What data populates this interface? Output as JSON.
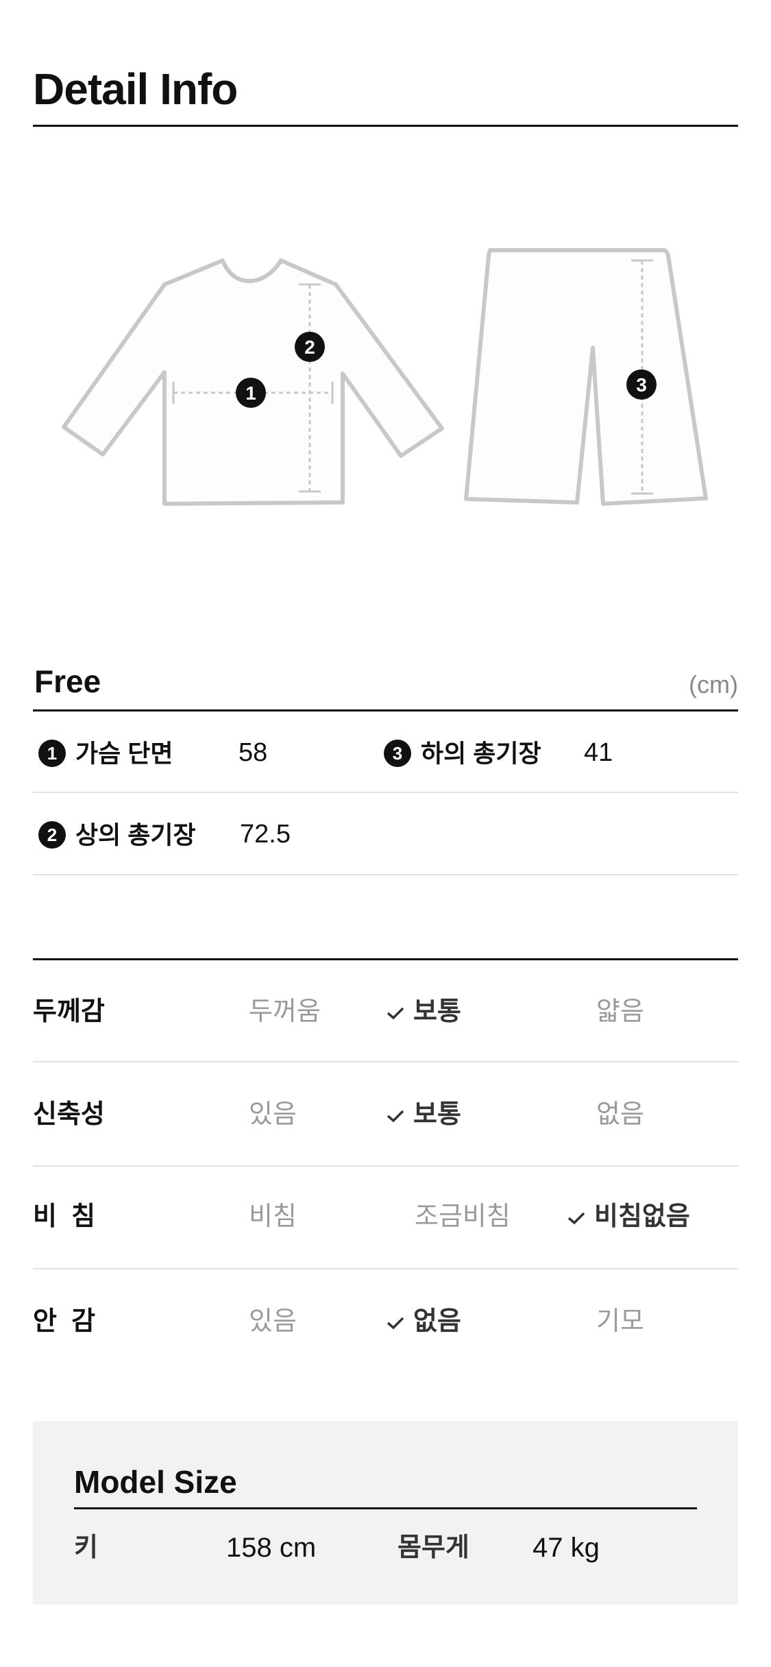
{
  "page": {
    "title": "Detail Info"
  },
  "diagram": {
    "top_markers": [
      "1",
      "2"
    ],
    "bottom_markers": [
      "3"
    ]
  },
  "size_table": {
    "size_name": "Free",
    "unit": "(cm)",
    "measurements": [
      {
        "num": "1",
        "label": "가슴 단면",
        "value": "58"
      },
      {
        "num": "3",
        "label": "하의 총기장",
        "value": "41"
      },
      {
        "num": "2",
        "label": "상의 총기장",
        "value": "72.5"
      }
    ]
  },
  "properties": [
    {
      "name": "두께감",
      "options": [
        "두꺼움",
        "보통",
        "얇음"
      ],
      "selected": "보통"
    },
    {
      "name": "신축성",
      "options": [
        "있음",
        "보통",
        "없음"
      ],
      "selected": "보통"
    },
    {
      "name": "비  침",
      "options": [
        "비침",
        "조금비침",
        "비침없음"
      ],
      "selected": "비침없음"
    },
    {
      "name": "안  감",
      "options": [
        "있음",
        "없음",
        "기모"
      ],
      "selected": "없음"
    }
  ],
  "model_size": {
    "title": "Model Size",
    "height_label": "키",
    "height_value": "158 cm",
    "weight_label": "몸무게",
    "weight_value": "47 kg"
  },
  "colors": {
    "accent": "#111111",
    "muted": "#9a9a9a",
    "panel": "#f2f2f2",
    "garment_stroke": "#c8c8c8"
  }
}
